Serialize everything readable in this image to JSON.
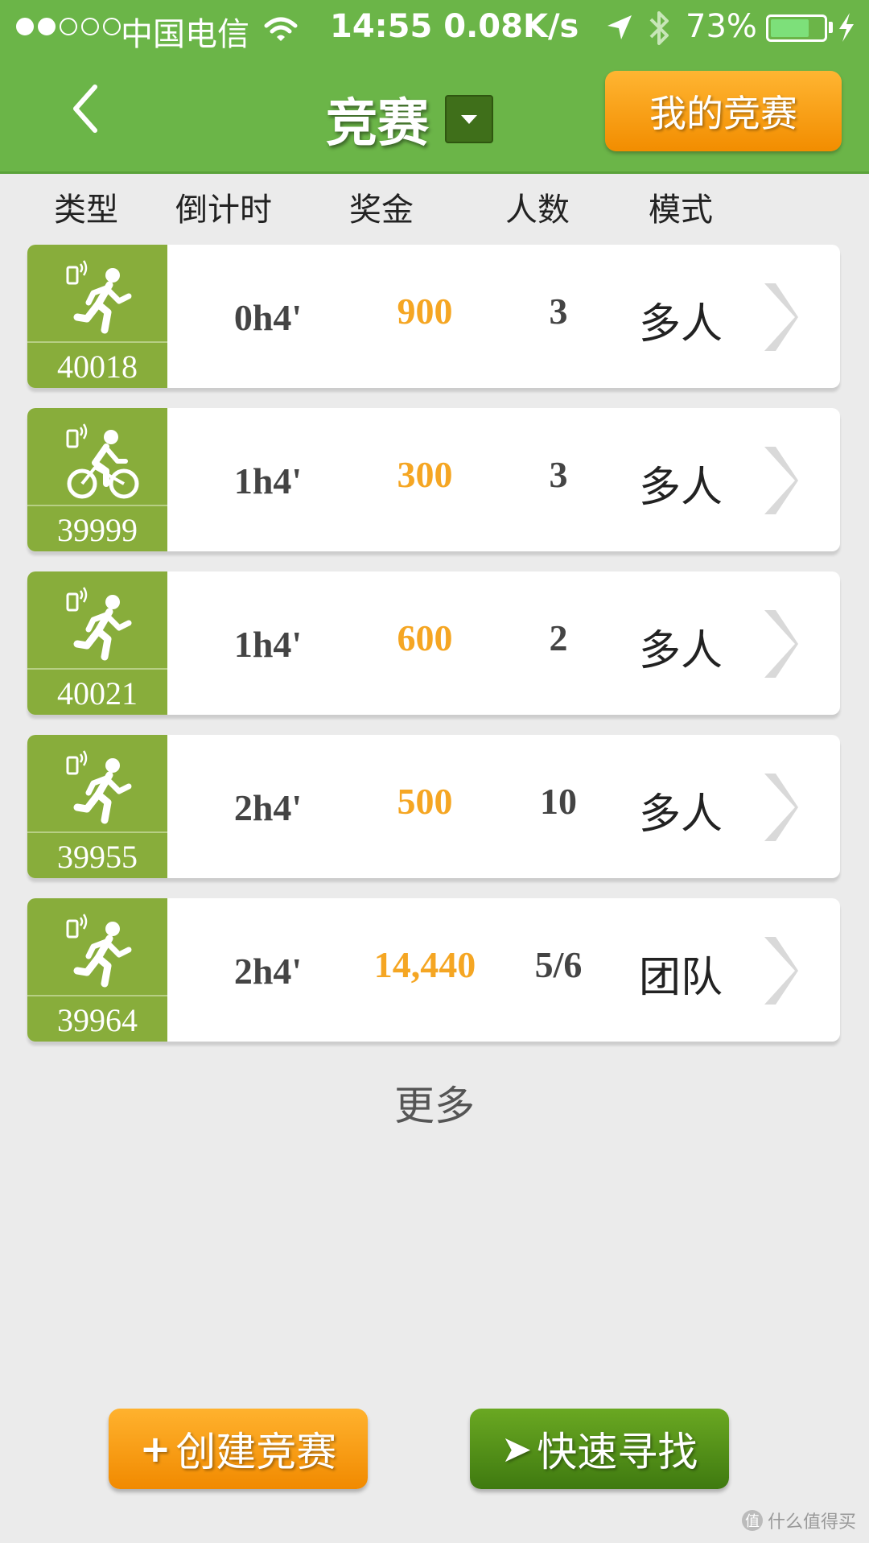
{
  "status_bar": {
    "carrier": "中国电信",
    "time_speed": "14:55 0.08K/s",
    "battery_pct": "73%",
    "battery_level": 0.73,
    "signal_dots_filled": 2,
    "signal_dots_total": 5
  },
  "nav": {
    "title": "竞赛",
    "my_races_label": "我的竞赛"
  },
  "columns": [
    "类型",
    "倒计时",
    "奖金",
    "人数",
    "模式"
  ],
  "races": [
    {
      "icon": "running-icon",
      "id": "40018",
      "countdown": "0h4'",
      "prize": "900",
      "people": "3",
      "mode": "多人"
    },
    {
      "icon": "cycling-icon",
      "id": "39999",
      "countdown": "1h4'",
      "prize": "300",
      "people": "3",
      "mode": "多人"
    },
    {
      "icon": "running-icon",
      "id": "40021",
      "countdown": "1h4'",
      "prize": "600",
      "people": "2",
      "mode": "多人"
    },
    {
      "icon": "running-icon",
      "id": "39955",
      "countdown": "2h4'",
      "prize": "500",
      "people": "10",
      "mode": "多人"
    },
    {
      "icon": "running-icon",
      "id": "39964",
      "countdown": "2h4'",
      "prize": "14,440",
      "people": "5/6",
      "mode": "团队"
    }
  ],
  "more_label": "更多",
  "buttons": {
    "create_glyph": "+",
    "create_label": "创建竞赛",
    "find_glyph": "➤",
    "find_label": "快速寻找"
  },
  "watermark": {
    "badge": "值",
    "text": "什么值得买"
  },
  "colors": {
    "header_green": "#6bb548",
    "type_green": "#88ad3b",
    "prize_orange": "#f5a623",
    "button_orange": "#f28d00",
    "button_green": "#4f8c16"
  }
}
